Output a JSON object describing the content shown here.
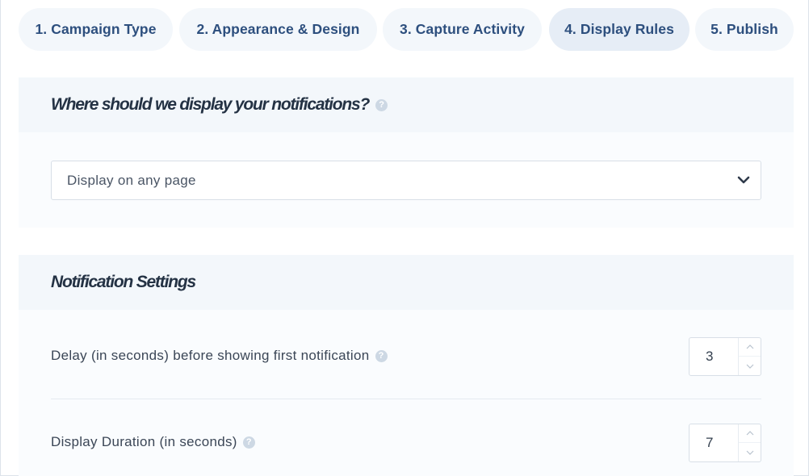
{
  "tabs": [
    {
      "label": "1. Campaign Type"
    },
    {
      "label": "2. Appearance & Design"
    },
    {
      "label": "3. Capture Activity"
    },
    {
      "label": "4. Display Rules",
      "active": true
    },
    {
      "label": "5. Publish"
    }
  ],
  "display_section": {
    "title": "Where should we display your notifications?",
    "help_icon": "help-icon",
    "select_value": "Display on any page",
    "select_icon": "chevron-down-icon"
  },
  "notification_settings": {
    "title": "Notification Settings",
    "delay": {
      "label": "Delay (in seconds) before showing first notification",
      "value": "3"
    },
    "duration": {
      "label": "Display Duration (in seconds)",
      "value": "7"
    }
  },
  "help_glyph": "?",
  "colors": {
    "tab_text": "#2d4f7e",
    "tab_bg": "#f3f7fb",
    "tab_active_bg": "#e6edf6",
    "panel_head_bg": "#f3f7fb"
  }
}
